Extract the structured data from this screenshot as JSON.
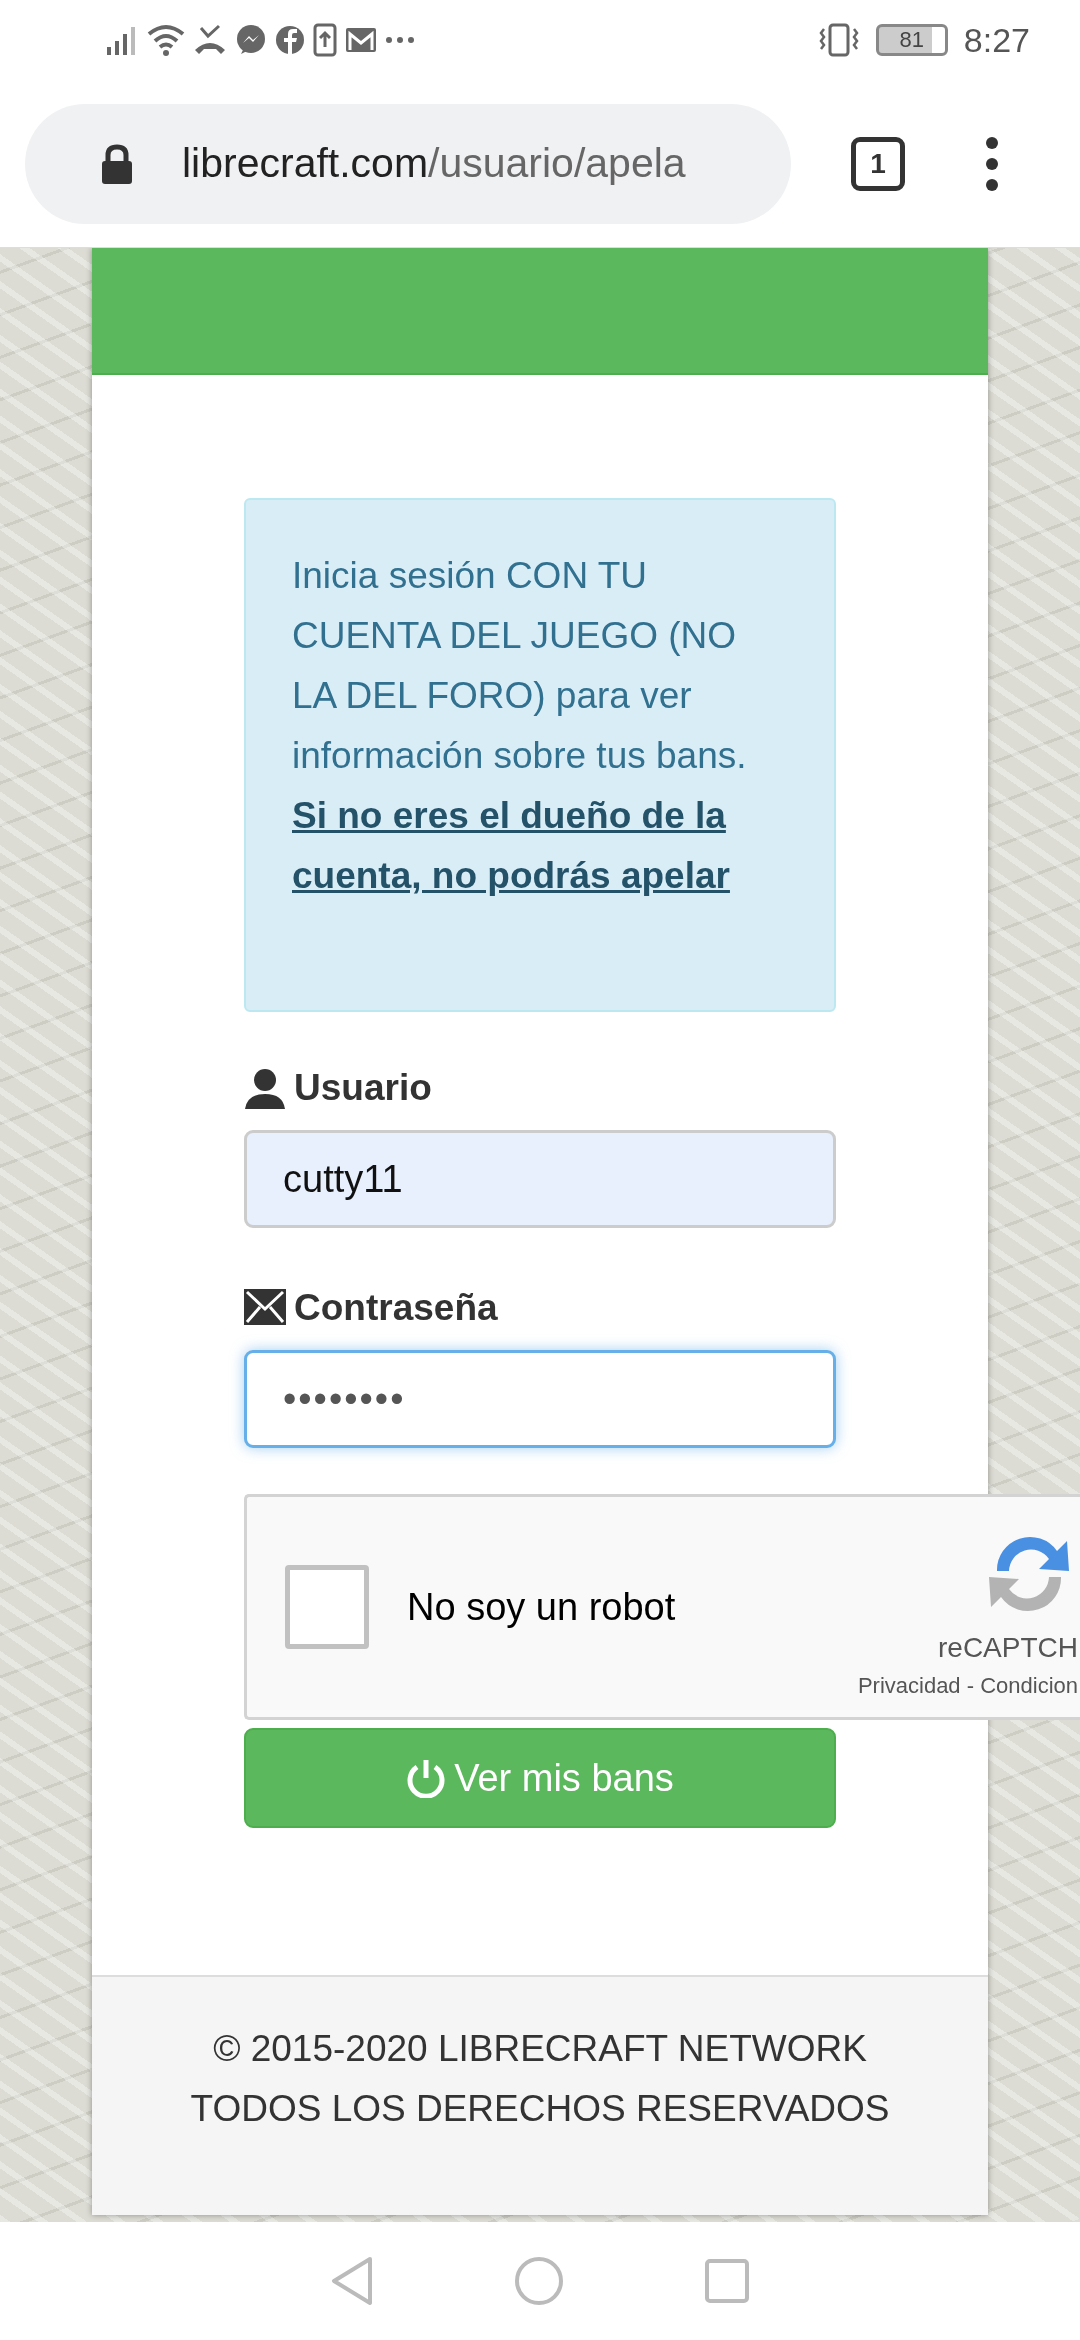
{
  "status_bar": {
    "time": "8:27",
    "battery": "81"
  },
  "browser": {
    "url_host": "librecraft.com",
    "url_path": "/usuario/apela",
    "tab_count": "1"
  },
  "alert": {
    "text": "Inicia sesión CON TU CUENTA DEL JUEGO (NO LA DEL FORO) para ver información sobre tus bans.",
    "link": "Si no eres el dueño de la cuenta, no podrás apelar"
  },
  "fields": [
    {
      "label": "Usuario",
      "kind": "user",
      "value": "cutty11",
      "autofilled": true,
      "focused": false
    },
    {
      "label": "Contraseña",
      "kind": "password",
      "value": "••••••••",
      "autofilled": false,
      "focused": true
    }
  ],
  "captcha": {
    "label": "No soy un robot",
    "checked": false,
    "brand": "reCAPTCH",
    "links": "Privacidad - Condicion"
  },
  "submit_button": "Ver mis bans",
  "footer": [
    "© 2015-2020 LIBRECRAFT NETWORK",
    "TODOS LOS DERECHOS RESERVADOS"
  ]
}
